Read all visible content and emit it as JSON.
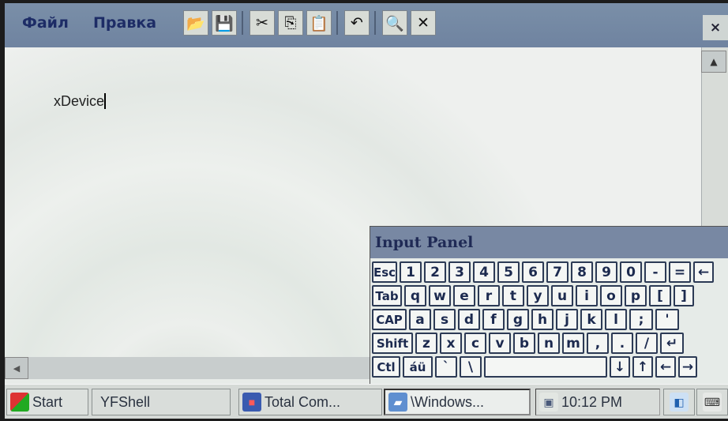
{
  "menu": {
    "file": "Файл",
    "edit": "Правка"
  },
  "toolbar": {
    "open_icon": "📂",
    "save_icon": "💾",
    "cut_icon": "✂",
    "copy_icon": "⎘",
    "paste_icon": "📋",
    "undo_icon": "↶",
    "find_icon": "🔍",
    "delete_icon": "✕"
  },
  "window": {
    "close": "×"
  },
  "document": {
    "text": "xDevice"
  },
  "scroll": {
    "up": "▲",
    "left": "◀"
  },
  "input_panel": {
    "title": "Input Panel",
    "rows": [
      [
        "Esc",
        "1",
        "2",
        "3",
        "4",
        "5",
        "6",
        "7",
        "8",
        "9",
        "0",
        "-",
        "=",
        "←"
      ],
      [
        "Tab",
        "q",
        "w",
        "e",
        "r",
        "t",
        "y",
        "u",
        "i",
        "o",
        "p",
        "[",
        "]"
      ],
      [
        "CAP",
        "a",
        "s",
        "d",
        "f",
        "g",
        "h",
        "j",
        "k",
        "l",
        ";",
        "'"
      ],
      [
        "Shift",
        "z",
        "x",
        "c",
        "v",
        "b",
        "n",
        "m",
        ",",
        ".",
        "/",
        "↵"
      ],
      [
        "Ctl",
        "áü",
        "`",
        "\\",
        "",
        "↓",
        "↑",
        "←",
        "→"
      ]
    ]
  },
  "taskbar": {
    "start": "Start",
    "yfshell": "YFShell",
    "total_commander": "Total Com...",
    "windows": "\\Windows...",
    "clock": "10:12 PM"
  },
  "colors": {
    "titlebar": "#7a8fa8",
    "key_border": "#2c3a55",
    "key_text": "#1c2a4f"
  }
}
